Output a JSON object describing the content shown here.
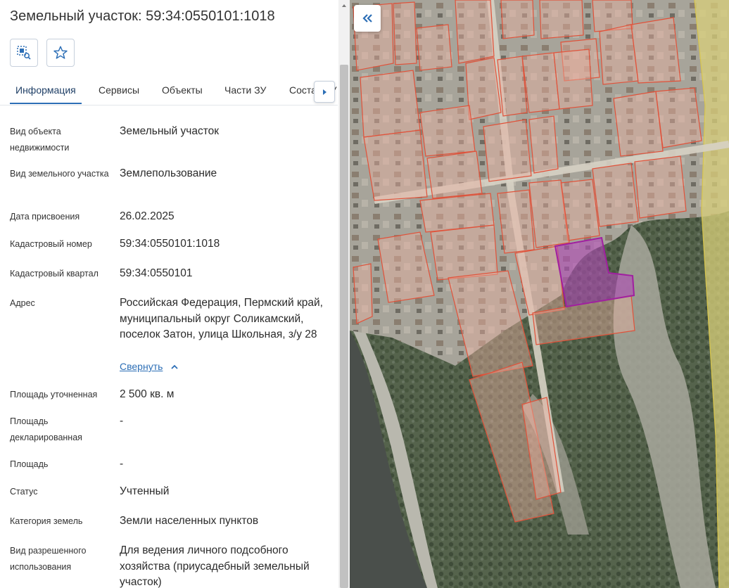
{
  "panel": {
    "title": "Земельный участок: 59:34:0550101:1018",
    "toolbar": {
      "select_icon": "select-area-icon",
      "favorite_icon": "star-icon"
    }
  },
  "tabs": [
    {
      "label": "Информация",
      "active": true
    },
    {
      "label": "Сервисы",
      "active": false
    },
    {
      "label": "Объекты",
      "active": false
    },
    {
      "label": "Части ЗУ",
      "active": false
    },
    {
      "label": "Состав ЗУ",
      "active": false
    }
  ],
  "info": {
    "object_type": {
      "label": "Вид объекта недвижимости",
      "value": "Земельный участок"
    },
    "parcel_type": {
      "label": "Вид земельного участка",
      "value": "Землепользование"
    },
    "assign_date": {
      "label": "Дата присвоения",
      "value": "26.02.2025"
    },
    "cadastral_number": {
      "label": "Кадастровый номер",
      "value": "59:34:0550101:1018"
    },
    "cadastral_quarter": {
      "label": "Кадастровый квартал",
      "value": "59:34:0550101"
    },
    "address": {
      "label": "Адрес",
      "value": "Российская Федерация, Пермский край, муниципальный округ Соликамский, поселок Затон, улица Школьная, з/у 28",
      "collapse_label": "Свернуть"
    },
    "area_specified": {
      "label": "Площадь уточненная",
      "value": "2 500 кв. м"
    },
    "area_declared": {
      "label": "Площадь декларированная",
      "value": "-"
    },
    "area": {
      "label": "Площадь",
      "value": "-"
    },
    "status": {
      "label": "Статус",
      "value": "Учтенный"
    },
    "land_category": {
      "label": "Категория земель",
      "value": "Земли населенных пунктов"
    },
    "permitted_use": {
      "label": "Вид разрешенного использования",
      "value": "Для ведения личного подсобного хозяйства (приусадебный земельный участок)"
    }
  },
  "colors": {
    "accent": "#2d6fb6",
    "parcel_outline": "#e0523a",
    "selected_parcel": "#a020a0"
  }
}
